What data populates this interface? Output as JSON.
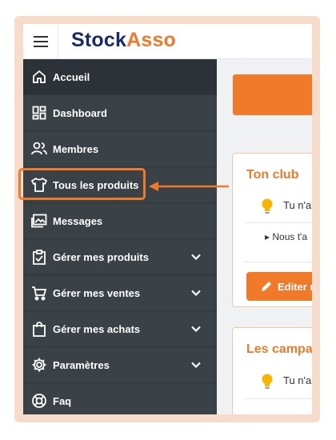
{
  "app": {
    "logo_part1": "Stock",
    "logo_part2": "Asso"
  },
  "colors": {
    "accent": "#f07a2a",
    "brand": "#1b2a6b",
    "sidebar": "#3a4147"
  },
  "sidebar": {
    "items": [
      {
        "label": "Accueil",
        "icon": "home-icon",
        "active": true
      },
      {
        "label": "Dashboard",
        "icon": "dashboard-icon"
      },
      {
        "label": "Membres",
        "icon": "members-icon"
      },
      {
        "label": "Tous les produits",
        "icon": "tshirt-icon",
        "highlighted": true
      },
      {
        "label": "Messages",
        "icon": "messages-icon"
      },
      {
        "label": "Gérer mes produits",
        "icon": "clipboard-check-icon",
        "expandable": true
      },
      {
        "label": "Gérer mes ventes",
        "icon": "cart-icon",
        "expandable": true
      },
      {
        "label": "Gérer mes achats",
        "icon": "shopping-bag-icon",
        "expandable": true
      },
      {
        "label": "Paramètres",
        "icon": "gear-icon",
        "expandable": true
      },
      {
        "label": "Faq",
        "icon": "lifebuoy-icon"
      }
    ]
  },
  "main": {
    "club_card": {
      "title": "Ton club",
      "tip": "Tu n'a",
      "detail": "▸ Nous t'a",
      "button": "Editer n"
    },
    "campaign_card": {
      "title": "Les campag",
      "tip": "Tu n'a"
    }
  }
}
